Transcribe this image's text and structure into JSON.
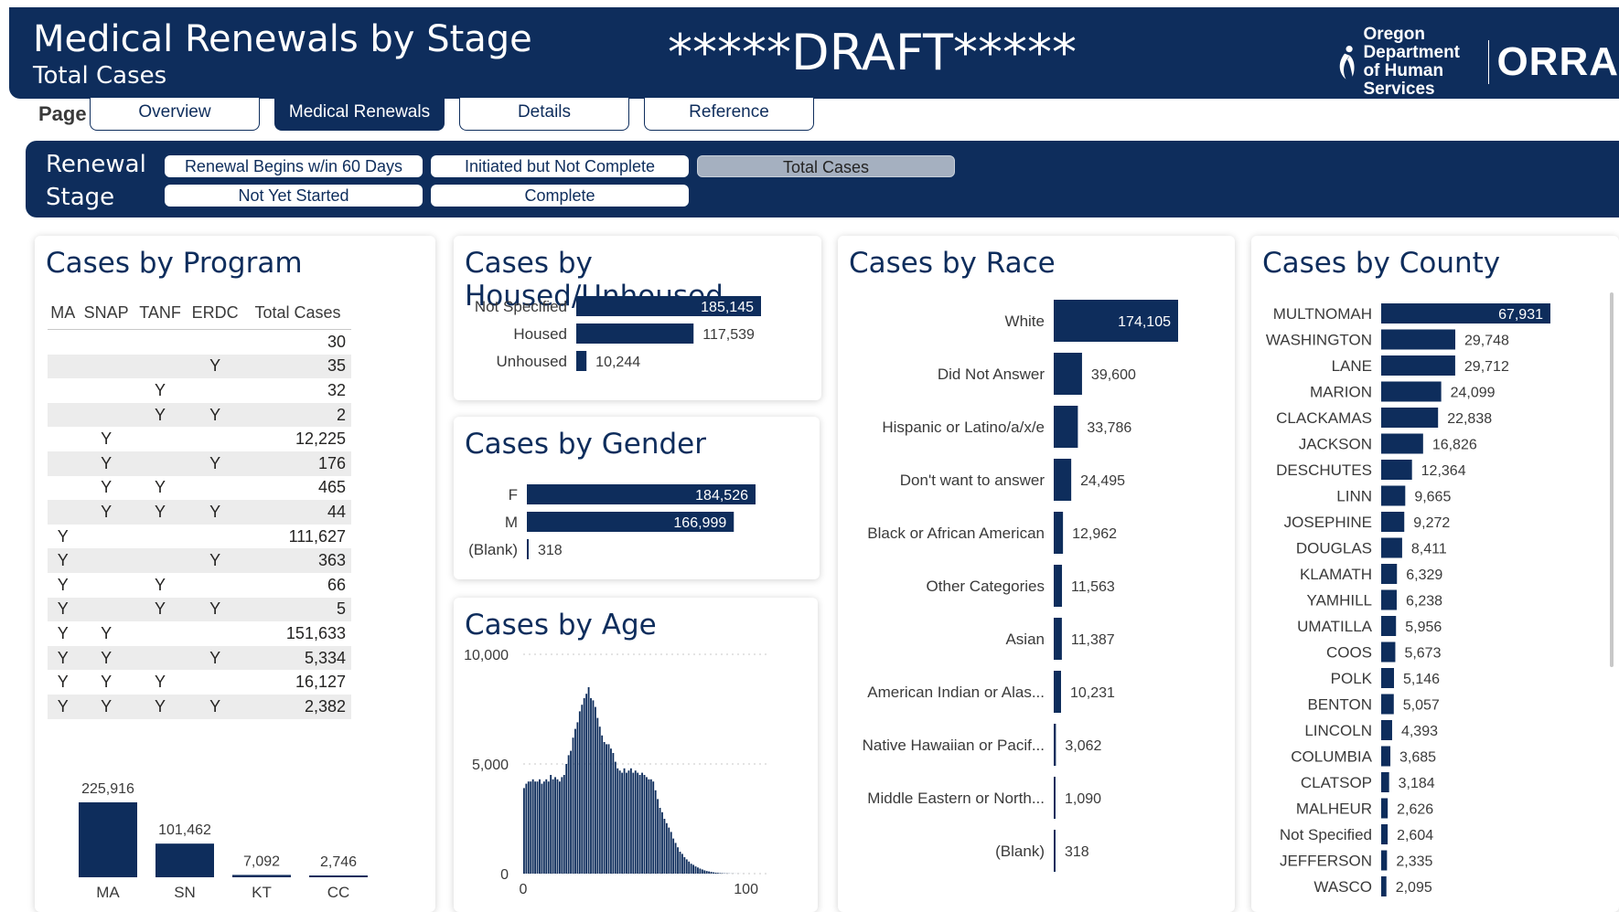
{
  "header": {
    "title": "Medical Renewals by Stage",
    "subtitle": "Total Cases",
    "draft": "*****DRAFT*****",
    "logo_line1": "Oregon Department",
    "logo_line2": "of Human Services",
    "logo_brand": "ORRA"
  },
  "nav": {
    "page_label": "Page",
    "tabs": [
      {
        "label": "Overview",
        "active": false
      },
      {
        "label": "Medical Renewals",
        "active": true
      },
      {
        "label": "Details",
        "active": false
      },
      {
        "label": "Reference",
        "active": false
      }
    ]
  },
  "stage": {
    "label_line1": "Renewal",
    "label_line2": "Stage",
    "options": [
      {
        "label": "Renewal Begins w/in 60 Days",
        "selected": false
      },
      {
        "label": "Initiated but Not Complete",
        "selected": false
      },
      {
        "label": "Total Cases",
        "selected": true
      },
      {
        "label": "Not Yet Started",
        "selected": false
      },
      {
        "label": "Complete",
        "selected": false
      }
    ]
  },
  "program": {
    "title": "Cases by Program",
    "columns": [
      "MA",
      "SNAP",
      "TANF",
      "ERDC",
      "Total Cases"
    ],
    "rows": [
      [
        "",
        "",
        "",
        "",
        "30"
      ],
      [
        "",
        "",
        "",
        "Y",
        "35"
      ],
      [
        "",
        "",
        "Y",
        "",
        "32"
      ],
      [
        "",
        "",
        "Y",
        "Y",
        "2"
      ],
      [
        "",
        "Y",
        "",
        "",
        "12,225"
      ],
      [
        "",
        "Y",
        "",
        "Y",
        "176"
      ],
      [
        "",
        "Y",
        "Y",
        "",
        "465"
      ],
      [
        "",
        "Y",
        "Y",
        "Y",
        "44"
      ],
      [
        "Y",
        "",
        "",
        "",
        "111,627"
      ],
      [
        "Y",
        "",
        "",
        "Y",
        "363"
      ],
      [
        "Y",
        "",
        "Y",
        "",
        "66"
      ],
      [
        "Y",
        "",
        "Y",
        "Y",
        "5"
      ],
      [
        "Y",
        "Y",
        "",
        "",
        "151,633"
      ],
      [
        "Y",
        "Y",
        "",
        "Y",
        "5,334"
      ],
      [
        "Y",
        "Y",
        "Y",
        "",
        "16,127"
      ],
      [
        "Y",
        "Y",
        "Y",
        "Y",
        "2,382"
      ]
    ],
    "summary": {
      "categories": [
        "MA",
        "SN",
        "KT",
        "CC"
      ],
      "labels": [
        "225,916",
        "101,462",
        "7,092",
        "2,746"
      ],
      "values": [
        225916,
        101462,
        7092,
        2746
      ]
    }
  },
  "housed": {
    "title": "Cases by Housed/Unhoused",
    "categories": [
      "Not Specified",
      "Housed",
      "Unhoused"
    ],
    "labels": [
      "185,145",
      "117,539",
      "10,244"
    ],
    "values": [
      185145,
      117539,
      10244
    ]
  },
  "gender": {
    "title": "Cases by Gender",
    "categories": [
      "F",
      "M",
      "(Blank)"
    ],
    "labels": [
      "184,526",
      "166,999",
      "318"
    ],
    "values": [
      184526,
      166999,
      318
    ]
  },
  "age": {
    "title": "Cases by Age",
    "y_ticks": [
      "10,000",
      "5,000",
      "0"
    ],
    "x_ticks": [
      "0",
      "100"
    ]
  },
  "race": {
    "title": "Cases by Race",
    "categories": [
      "White",
      "Did Not Answer",
      "Hispanic or Latino/a/x/e",
      "Don't want to answer",
      "Black or African American",
      "Other Categories",
      "Asian",
      "American Indian or Alas...",
      "Native Hawaiian or Pacif...",
      "Middle Eastern or North...",
      "(Blank)"
    ],
    "labels": [
      "174,105",
      "39,600",
      "33,786",
      "24,495",
      "12,962",
      "11,563",
      "11,387",
      "10,231",
      "3,062",
      "1,090",
      "318"
    ],
    "values": [
      174105,
      39600,
      33786,
      24495,
      12962,
      11563,
      11387,
      10231,
      3062,
      1090,
      318
    ]
  },
  "county": {
    "title": "Cases by County",
    "categories": [
      "MULTNOMAH",
      "WASHINGTON",
      "LANE",
      "MARION",
      "CLACKAMAS",
      "JACKSON",
      "DESCHUTES",
      "LINN",
      "JOSEPHINE",
      "DOUGLAS",
      "KLAMATH",
      "YAMHILL",
      "UMATILLA",
      "COOS",
      "POLK",
      "BENTON",
      "LINCOLN",
      "COLUMBIA",
      "CLATSOP",
      "MALHEUR",
      "Not Specified",
      "JEFFERSON",
      "WASCO"
    ],
    "labels": [
      "67,931",
      "29,748",
      "29,712",
      "24,099",
      "22,838",
      "16,826",
      "12,364",
      "9,665",
      "9,272",
      "8,411",
      "6,329",
      "6,238",
      "5,956",
      "5,673",
      "5,146",
      "5,057",
      "4,393",
      "3,685",
      "3,184",
      "2,626",
      "2,604",
      "2,335",
      "2,095"
    ],
    "values": [
      67931,
      29748,
      29712,
      24099,
      22838,
      16826,
      12364,
      9665,
      9272,
      8411,
      6329,
      6238,
      5956,
      5673,
      5146,
      5057,
      4393,
      3685,
      3184,
      2626,
      2604,
      2335,
      2095
    ]
  },
  "chart_data": [
    {
      "type": "bar",
      "title": "Cases by Housed/Unhoused",
      "categories": [
        "Not Specified",
        "Housed",
        "Unhoused"
      ],
      "values": [
        185145,
        117539,
        10244
      ]
    },
    {
      "type": "bar",
      "title": "Cases by Gender",
      "categories": [
        "F",
        "M",
        "(Blank)"
      ],
      "values": [
        184526,
        166999,
        318
      ]
    },
    {
      "type": "bar",
      "title": "Cases by Race",
      "categories": [
        "White",
        "Did Not Answer",
        "Hispanic or Latino/a/x/e",
        "Don't want to answer",
        "Black or African American",
        "Other Categories",
        "Asian",
        "American Indian or Alas...",
        "Native Hawaiian or Pacif...",
        "Middle Eastern or North...",
        "(Blank)"
      ],
      "values": [
        174105,
        39600,
        33786,
        24495,
        12962,
        11563,
        11387,
        10231,
        3062,
        1090,
        318
      ]
    },
    {
      "type": "bar",
      "title": "Cases by County",
      "categories": [
        "MULTNOMAH",
        "WASHINGTON",
        "LANE",
        "MARION",
        "CLACKAMAS",
        "JACKSON",
        "DESCHUTES",
        "LINN",
        "JOSEPHINE",
        "DOUGLAS",
        "KLAMATH",
        "YAMHILL",
        "UMATILLA",
        "COOS",
        "POLK",
        "BENTON",
        "LINCOLN",
        "COLUMBIA",
        "CLATSOP",
        "MALHEUR",
        "Not Specified",
        "JEFFERSON",
        "WASCO"
      ],
      "values": [
        67931,
        29748,
        29712,
        24099,
        22838,
        16826,
        12364,
        9665,
        9272,
        8411,
        6329,
        6238,
        5956,
        5673,
        5146,
        5057,
        4393,
        3685,
        3184,
        2626,
        2604,
        2335,
        2095
      ]
    },
    {
      "type": "bar",
      "title": "",
      "categories": [
        "MA",
        "SN",
        "KT",
        "CC"
      ],
      "values": [
        225916,
        101462,
        7092,
        2746
      ]
    },
    {
      "type": "bar",
      "title": "Cases by Age",
      "ylim": [
        0,
        10000
      ],
      "xlim": [
        0,
        110
      ],
      "x": [
        0,
        1,
        2,
        3,
        4,
        5,
        6,
        7,
        8,
        9,
        10,
        11,
        12,
        13,
        14,
        15,
        16,
        17,
        18,
        19,
        20,
        21,
        22,
        23,
        24,
        25,
        26,
        27,
        28,
        29,
        30,
        31,
        32,
        33,
        34,
        35,
        36,
        37,
        38,
        39,
        40,
        41,
        42,
        43,
        44,
        45,
        46,
        47,
        48,
        49,
        50,
        51,
        52,
        53,
        54,
        55,
        56,
        57,
        58,
        59,
        60,
        61,
        62,
        63,
        64,
        65,
        66,
        67,
        68,
        69,
        70,
        71,
        72,
        73,
        74,
        75,
        76,
        77,
        78,
        79,
        80,
        81,
        82,
        83,
        84,
        85,
        86,
        87,
        88,
        89,
        90,
        91,
        92,
        93,
        94,
        95,
        96,
        97,
        98,
        99,
        100,
        101,
        102,
        103,
        104,
        105
      ],
      "values": [
        3900,
        4100,
        4200,
        4200,
        4300,
        4200,
        4200,
        4300,
        4100,
        4200,
        4300,
        4200,
        4500,
        4300,
        4400,
        4300,
        4200,
        4400,
        4500,
        5000,
        5400,
        5600,
        6200,
        6600,
        6900,
        7400,
        7700,
        8000,
        8200,
        8500,
        8000,
        7900,
        7600,
        7100,
        6700,
        6300,
        6000,
        5900,
        5900,
        5700,
        5500,
        5100,
        4800,
        4700,
        4600,
        4800,
        4600,
        4700,
        4800,
        4600,
        4700,
        4600,
        4500,
        4600,
        4500,
        4400,
        4300,
        4300,
        4200,
        3800,
        3400,
        3000,
        2800,
        2500,
        2300,
        2100,
        1900,
        1600,
        1400,
        1200,
        1000,
        900,
        750,
        650,
        550,
        450,
        400,
        330,
        280,
        230,
        190,
        150,
        120,
        100,
        80,
        60,
        45,
        35,
        25,
        18,
        14,
        10,
        8,
        5,
        4,
        3,
        2,
        2,
        1,
        1,
        1,
        1,
        0,
        0,
        0,
        0
      ]
    }
  ]
}
